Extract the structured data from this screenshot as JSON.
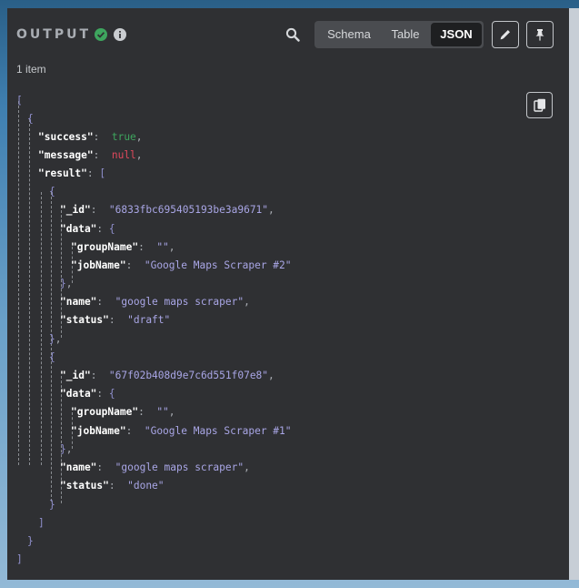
{
  "header": {
    "title": "OUTPUT",
    "view_modes": [
      "Schema",
      "Table",
      "JSON"
    ],
    "active_view": "JSON"
  },
  "item_count": "1 item",
  "json_view": {
    "success": "true",
    "message": "null",
    "results": [
      {
        "_id": "\"6833fbc695405193be3a9671\"",
        "groupName": "\"\"",
        "jobName": "\"Google Maps Scraper #2\"",
        "name": "\"google maps scraper\"",
        "status": "\"draft\""
      },
      {
        "_id": "\"67f02b408d9e7c6d551f07e8\"",
        "groupName": "\"\"",
        "jobName": "\"Google Maps Scraper #1\"",
        "name": "\"google maps scraper\"",
        "status": "\"done\""
      }
    ]
  },
  "colors": {
    "panel_bg": "#2f3033",
    "success_green": "#3ea55e",
    "null_red": "#e0485c",
    "string_lilac": "#a9a6e6"
  },
  "icons": [
    "check-circle-icon",
    "info-icon",
    "search-icon",
    "pencil-icon",
    "pin-icon",
    "copy-icon"
  ]
}
